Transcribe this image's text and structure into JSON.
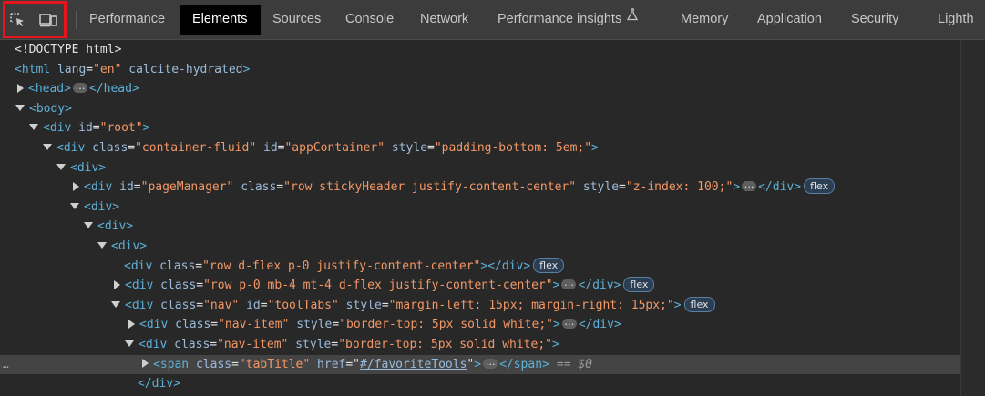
{
  "toolbar": {
    "inspect_icon": "select-element-icon",
    "device_icon": "device-toolbar-icon",
    "highlight_color": "#e4161b"
  },
  "tabs": [
    {
      "label": "Performance"
    },
    {
      "label": "Elements",
      "active": true
    },
    {
      "label": "Sources"
    },
    {
      "label": "Console"
    },
    {
      "label": "Network"
    },
    {
      "label": "Performance insights"
    },
    {
      "label": "Memory"
    },
    {
      "label": "Application"
    },
    {
      "label": "Security"
    },
    {
      "label": "Lighth"
    }
  ],
  "tree": {
    "doctype": "<!DOCTYPE html>",
    "html_open": "<html",
    "html_lang_attr": " lang",
    "html_lang_val": "\"en\"",
    "html_rest": " calcite-hydrated",
    "head_open": "<head>",
    "head_close": "</head>",
    "body_open": "<body>",
    "root_tag": "<div",
    "root_attr": " id",
    "root_val": "\"root\"",
    "container_tag": "<div",
    "container_class_attr": " class",
    "container_class_val": "\"container-fluid\"",
    "container_id_attr": " id",
    "container_id_val": "\"appContainer\"",
    "container_style_attr": " style",
    "container_style_val": "\"padding-bottom: 5em;\"",
    "div1": "<div>",
    "pm_tag": "<div",
    "pm_id_attr": " id",
    "pm_id_val": "\"pageManager\"",
    "pm_class_attr": " class",
    "pm_class_val": "\"row stickyHeader justify-content-center\"",
    "pm_style_attr": " style",
    "pm_style_val": "\"z-index: 100;\"",
    "div_close": "</div>",
    "div2": "<div>",
    "div3": "<div>",
    "div4": "<div>",
    "r1_tag": "<div",
    "r1_class_attr": " class",
    "r1_class_val": "\"row d-flex p-0 justify-content-center\"",
    "r2_tag": "<div",
    "r2_class_attr": " class",
    "r2_class_val": "\"row p-0 mb-4 mt-4 d-flex justify-content-center\"",
    "nav_tag": "<div",
    "nav_class_attr": " class",
    "nav_class_val": "\"nav\"",
    "nav_id_attr": " id",
    "nav_id_val": "\"toolTabs\"",
    "nav_style_attr": " style",
    "nav_style_val": "\"margin-left: 15px; margin-right: 15px;\"",
    "ni1_tag": "<div",
    "ni1_class_attr": " class",
    "ni1_class_val": "\"nav-item\"",
    "ni1_style_attr": " style",
    "ni1_style_val": "\"border-top: 5px solid white;\"",
    "ni2_tag": "<div",
    "ni2_class_attr": " class",
    "ni2_class_val": "\"nav-item\"",
    "ni2_style_attr": " style",
    "ni2_style_val": "\"border-top: 5px solid white;\"",
    "span_tag": "<span",
    "span_class_attr": " class",
    "span_class_val": "\"tabTitle\"",
    "span_href_attr": " href",
    "span_href_val": "#/favoriteTools",
    "span_close": "</span>",
    "selected_marker": "== $0",
    "last_close": "</div>",
    "flex_badge": "flex",
    "ellipsis_glyph": "…",
    "row_dots": "…"
  }
}
